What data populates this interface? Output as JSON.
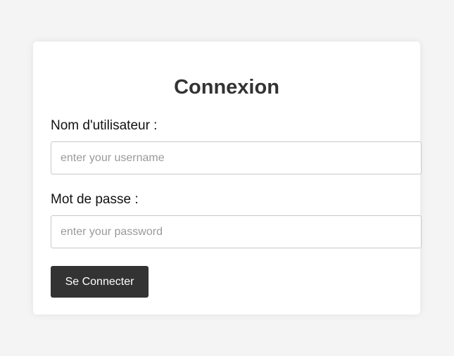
{
  "form": {
    "title": "Connexion",
    "username_label": "Nom d'utilisateur :",
    "username_placeholder": "enter your username",
    "password_label": "Mot de passe :",
    "password_placeholder": "enter your password",
    "submit_label": "Se Connecter"
  },
  "colors": {
    "page_background": "#f4f4f4",
    "card_background": "#ffffff",
    "button_background": "#333333",
    "button_text": "#ffffff"
  }
}
